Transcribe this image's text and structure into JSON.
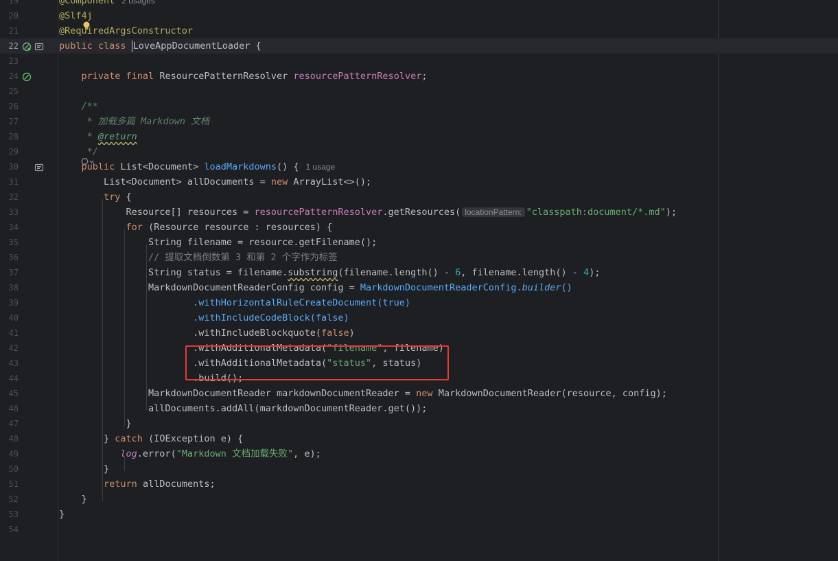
{
  "editor": {
    "language": "java",
    "caret_line": "22",
    "highlight_box_color": "#e53935"
  },
  "gutter_icons": [
    {
      "line": "22",
      "icons": [
        "bean-gutter-icon",
        "implementation-gutter-icon"
      ]
    },
    {
      "line": "24",
      "icons": [
        "bean-injection-gutter-icon"
      ]
    },
    {
      "line": "30",
      "icons": [
        "implementation-gutter-icon"
      ]
    }
  ],
  "lines": [
    {
      "num": "19",
      "tokens": [
        {
          "c": "ann",
          "t": "@Component"
        },
        {
          "c": "hint",
          "t": "2 usages"
        }
      ]
    },
    {
      "num": "20",
      "tokens": [
        {
          "c": "ann",
          "t": "@Slf4j"
        }
      ]
    },
    {
      "num": "21",
      "tokens": [
        {
          "c": "ann",
          "t": "@RequiredArgsConstructor"
        }
      ]
    },
    {
      "num": "22",
      "tokens": [
        {
          "c": "kw",
          "t": "public class "
        },
        {
          "c": "caret",
          "t": ""
        },
        {
          "c": "",
          "t": "LoveAppDocumentLoader {"
        }
      ]
    },
    {
      "num": "23",
      "tokens": []
    },
    {
      "num": "24",
      "tokens": [
        {
          "c": "",
          "t": "    "
        },
        {
          "c": "kw",
          "t": "private final "
        },
        {
          "c": "",
          "t": "ResourcePatternResolver "
        },
        {
          "c": "fld",
          "t": "resourcePatternResolver"
        },
        {
          "c": "",
          "t": ";"
        }
      ]
    },
    {
      "num": "25",
      "tokens": []
    },
    {
      "num": "26",
      "tokens": [
        {
          "c": "doc",
          "t": "    /**"
        }
      ]
    },
    {
      "num": "27",
      "tokens": [
        {
          "c": "doc",
          "t": "     * 加载多篇 Markdown 文档"
        }
      ]
    },
    {
      "num": "28",
      "tokens": [
        {
          "c": "doc",
          "t": "     * "
        },
        {
          "c": "doctag",
          "t": "@return"
        }
      ]
    },
    {
      "num": "29",
      "tokens": [
        {
          "c": "doc",
          "t": "     */"
        }
      ]
    },
    {
      "num": "30",
      "tokens": [
        {
          "c": "",
          "t": "    "
        },
        {
          "c": "kw",
          "t": "public "
        },
        {
          "c": "",
          "t": "List<Document> "
        },
        {
          "c": "fn",
          "t": "loadMarkdowns"
        },
        {
          "c": "",
          "t": "() {"
        },
        {
          "c": "hint",
          "t": "1 usage"
        }
      ]
    },
    {
      "num": "31",
      "tokens": [
        {
          "c": "",
          "t": "        List<Document> allDocuments = "
        },
        {
          "c": "kw",
          "t": "new "
        },
        {
          "c": "",
          "t": "ArrayList<>();"
        }
      ]
    },
    {
      "num": "32",
      "tokens": [
        {
          "c": "",
          "t": "        "
        },
        {
          "c": "kw",
          "t": "try "
        },
        {
          "c": "",
          "t": "{"
        }
      ]
    },
    {
      "num": "33",
      "tokens": [
        {
          "c": "",
          "t": "            Resource[] resources = "
        },
        {
          "c": "fld",
          "t": "resourcePatternResolver"
        },
        {
          "c": "",
          "t": ".getResources("
        },
        {
          "c": "inlay",
          "t": "locationPattern:"
        },
        {
          "c": "str",
          "t": "\"classpath:document/*.md\""
        },
        {
          "c": "",
          "t": ");"
        }
      ]
    },
    {
      "num": "34",
      "tokens": [
        {
          "c": "",
          "t": "            "
        },
        {
          "c": "kw",
          "t": "for "
        },
        {
          "c": "",
          "t": "(Resource resource : resources) {"
        }
      ]
    },
    {
      "num": "35",
      "tokens": [
        {
          "c": "",
          "t": "                String filename = resource.getFilename();"
        }
      ]
    },
    {
      "num": "36",
      "tokens": [
        {
          "c": "cmt",
          "t": "                // 提取文档倒数第 3 和第 2 个字作为标签"
        }
      ]
    },
    {
      "num": "37",
      "tokens": [
        {
          "c": "",
          "t": "                String status = filename."
        },
        {
          "c": "squig",
          "t": "substring"
        },
        {
          "c": "",
          "t": "(filename.length() - "
        },
        {
          "c": "num",
          "t": "6"
        },
        {
          "c": "",
          "t": ", filename.length() - "
        },
        {
          "c": "num",
          "t": "4"
        },
        {
          "c": "",
          "t": ");"
        }
      ]
    },
    {
      "num": "38",
      "tokens": [
        {
          "c": "",
          "t": "                MarkdownDocumentReaderConfig config = "
        },
        {
          "c": "call",
          "t": "MarkdownDocumentReaderConfig."
        },
        {
          "c": "stat",
          "t": "builder"
        },
        {
          "c": "call",
          "t": "()"
        }
      ]
    },
    {
      "num": "39",
      "tokens": [
        {
          "c": "",
          "t": "                        "
        },
        {
          "c": "call",
          "t": ".withHorizontalRuleCreateDocument(true)"
        }
      ]
    },
    {
      "num": "40",
      "tokens": [
        {
          "c": "",
          "t": "                        "
        },
        {
          "c": "call",
          "t": ".withIncludeCodeBlock(false)"
        }
      ]
    },
    {
      "num": "41",
      "tokens": [
        {
          "c": "",
          "t": "                        .withIncludeBlockquote("
        },
        {
          "c": "kw",
          "t": "false"
        },
        {
          "c": "",
          "t": ")"
        }
      ]
    },
    {
      "num": "42",
      "tokens": [
        {
          "c": "",
          "t": "                        .withAdditionalMetadata("
        },
        {
          "c": "str",
          "t": "\"filename\""
        },
        {
          "c": "",
          "t": ", filename)"
        }
      ]
    },
    {
      "num": "43",
      "tokens": [
        {
          "c": "",
          "t": "                        .withAdditionalMetadata("
        },
        {
          "c": "str",
          "t": "\"status\""
        },
        {
          "c": "",
          "t": ", status)"
        }
      ]
    },
    {
      "num": "44",
      "tokens": [
        {
          "c": "",
          "t": "                        .build();"
        }
      ]
    },
    {
      "num": "45",
      "tokens": [
        {
          "c": "",
          "t": "                MarkdownDocumentReader markdownDocumentReader = "
        },
        {
          "c": "kw",
          "t": "new "
        },
        {
          "c": "",
          "t": "MarkdownDocumentReader(resource, config);"
        }
      ]
    },
    {
      "num": "46",
      "tokens": [
        {
          "c": "",
          "t": "                allDocuments.addAll(markdownDocumentReader.get());"
        }
      ]
    },
    {
      "num": "47",
      "tokens": [
        {
          "c": "",
          "t": "            }"
        }
      ]
    },
    {
      "num": "48",
      "tokens": [
        {
          "c": "",
          "t": "        } "
        },
        {
          "c": "kw",
          "t": "catch "
        },
        {
          "c": "",
          "t": "(IOException e) {"
        }
      ]
    },
    {
      "num": "49",
      "tokens": [
        {
          "c": "",
          "t": "           "
        },
        {
          "c": "logv",
          "t": "log"
        },
        {
          "c": "",
          "t": ".error("
        },
        {
          "c": "str",
          "t": "\"Markdown 文档加载失败\""
        },
        {
          "c": "",
          "t": ", e);"
        }
      ]
    },
    {
      "num": "50",
      "tokens": [
        {
          "c": "",
          "t": "        }"
        }
      ]
    },
    {
      "num": "51",
      "tokens": [
        {
          "c": "",
          "t": "        "
        },
        {
          "c": "kw",
          "t": "return "
        },
        {
          "c": "",
          "t": "allDocuments;"
        }
      ]
    },
    {
      "num": "52",
      "tokens": [
        {
          "c": "",
          "t": "    }"
        }
      ]
    },
    {
      "num": "53",
      "tokens": [
        {
          "c": "",
          "t": "}"
        }
      ]
    },
    {
      "num": "54",
      "tokens": []
    }
  ]
}
